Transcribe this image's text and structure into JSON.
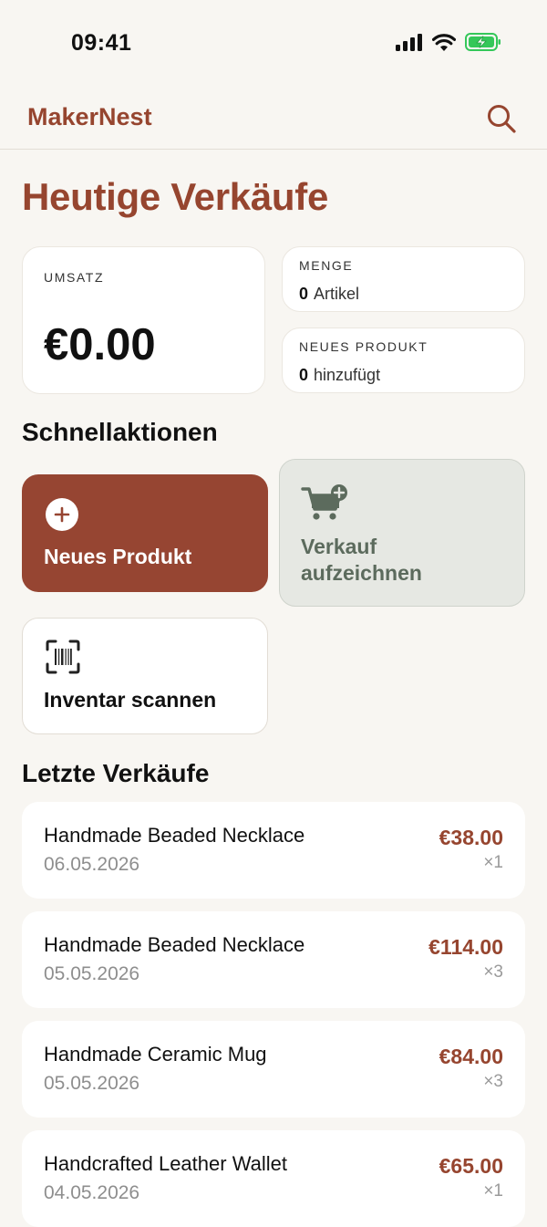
{
  "status_bar": {
    "time": "09:41",
    "icons": [
      "cellular-signal-icon",
      "wifi-icon",
      "battery-charging-icon"
    ],
    "battery_color": "#34c759"
  },
  "nav": {
    "brand": "MakerNest",
    "search_icon": "search-icon"
  },
  "page_title": "Heutige Verkäufe",
  "stats": {
    "revenue": {
      "label": "UMSATZ",
      "value": "€0.00"
    },
    "quantity": {
      "label": "MENGE",
      "count": "0",
      "unit": "Artikel"
    },
    "new_product": {
      "label": "NEUES PRODUKT",
      "count": "0",
      "unit": "hinzufügt"
    }
  },
  "quick_actions": {
    "title": "Schnellaktionen",
    "new_product": {
      "label": "Neues Produkt",
      "icon": "plus-circle-icon"
    },
    "record_sale": {
      "label_line1": "Verkauf",
      "label_line2": "aufzeichnen",
      "icon": "cart-add-icon"
    },
    "scan_inventory": {
      "label": "Inventar scannen",
      "icon": "barcode-scan-icon"
    }
  },
  "recent_sales": {
    "title": "Letzte Verkäufe",
    "items": [
      {
        "name": "Handmade Beaded Necklace",
        "date": "06.05.2026",
        "price": "€38.00",
        "qty": "×1"
      },
      {
        "name": "Handmade Beaded Necklace",
        "date": "05.05.2026",
        "price": "€114.00",
        "qty": "×3"
      },
      {
        "name": "Handmade Ceramic Mug",
        "date": "05.05.2026",
        "price": "€84.00",
        "qty": "×3"
      },
      {
        "name": "Handcrafted Leather Wallet",
        "date": "04.05.2026",
        "price": "€65.00",
        "qty": "×1"
      }
    ]
  },
  "colors": {
    "accent": "#96452f",
    "background": "#f8f6f2",
    "sage_card": "#e6e8e3",
    "sage_text": "#5c6b5d"
  }
}
